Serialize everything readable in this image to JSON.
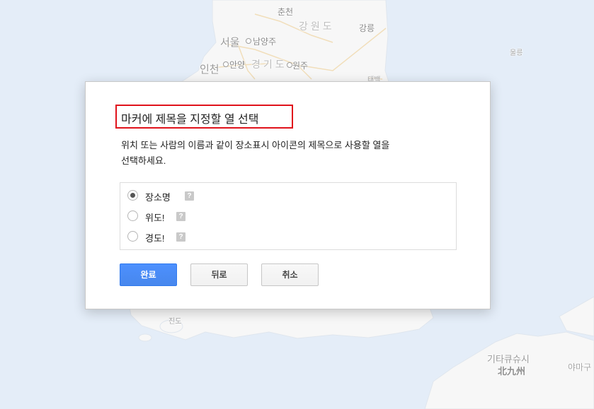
{
  "map": {
    "labels": [
      "춘천",
      "강원도",
      "강릉",
      "서울",
      "남양주",
      "인천",
      "안양",
      "경기도",
      "원주",
      "태백",
      "울릉",
      "진도",
      "기타큐슈시",
      "北九州",
      "야마구"
    ]
  },
  "dialog": {
    "title": "마커에 제목을 지정할 열 선택",
    "description_lines": [
      "위치 또는 사람의 이름과 같이 장소표시 아이콘의 제목으로 사용할 열을",
      "선택하세요."
    ],
    "options": [
      {
        "label": "장소명",
        "selected": true,
        "icon": "help-icon"
      },
      {
        "label": "위도!",
        "selected": false,
        "icon": "help-icon"
      },
      {
        "label": "경도!",
        "selected": false,
        "icon": "help-icon"
      }
    ],
    "buttons": {
      "done": "완료",
      "back": "뒤로",
      "cancel": "취소"
    }
  },
  "colors": {
    "primary_button": "#4d90fe",
    "highlight_box": "#e0121b",
    "sea": "#e4edf8",
    "land": "#f7f7f7"
  }
}
